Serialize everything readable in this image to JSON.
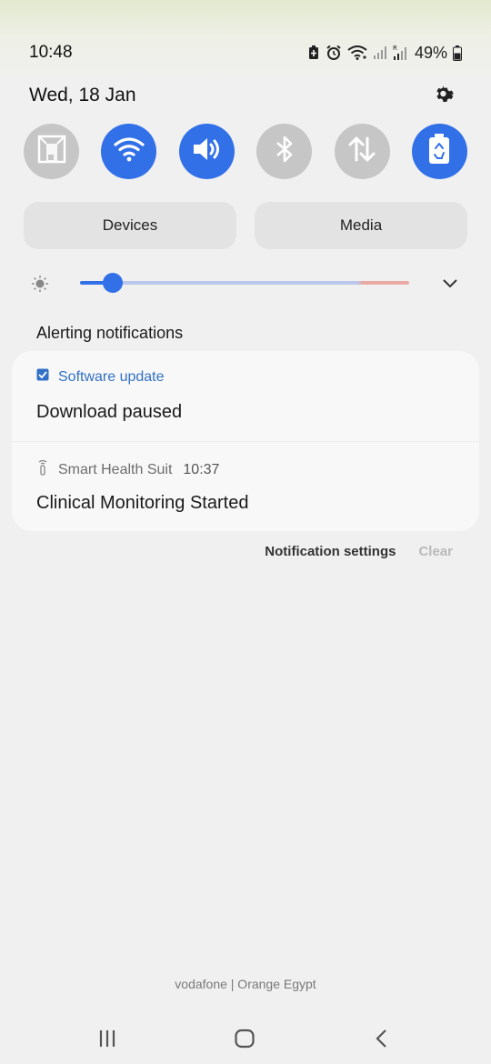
{
  "status_bar": {
    "time": "10:48",
    "battery_percent": "49%",
    "icons": [
      "battery-saver-icon",
      "alarm-icon",
      "wifi-icon",
      "signal-icon",
      "signal-roaming-icon",
      "battery-icon"
    ]
  },
  "header": {
    "date": "Wed, 18 Jan",
    "settings_icon": "gear-icon"
  },
  "quick_tiles": [
    {
      "name": "screen-capture",
      "icon": "screen-capture-icon",
      "active": false
    },
    {
      "name": "wifi",
      "icon": "wifi-icon",
      "active": true
    },
    {
      "name": "sound",
      "icon": "speaker-icon",
      "active": true
    },
    {
      "name": "bluetooth",
      "icon": "bluetooth-icon",
      "active": false
    },
    {
      "name": "mobile-data",
      "icon": "data-arrows-icon",
      "active": false
    },
    {
      "name": "power-saving",
      "icon": "battery-recycle-icon",
      "active": true
    }
  ],
  "pills": {
    "devices_label": "Devices",
    "media_label": "Media"
  },
  "brightness": {
    "level": 0.1,
    "icon": "sun-icon",
    "expand_icon": "chevron-down-icon"
  },
  "notifications": {
    "section_title": "Alerting notifications",
    "items": [
      {
        "app": "Software update",
        "app_icon": "checkbox-icon",
        "time": "",
        "body": "Download paused"
      },
      {
        "app": "Smart Health Suit",
        "app_icon": "sensor-icon",
        "time": "10:37",
        "body": "Clinical Monitoring Started"
      }
    ],
    "settings_label": "Notification settings",
    "clear_label": "Clear"
  },
  "carrier": "vodafone | Orange Egypt",
  "nav": {
    "recents_icon": "recents-icon",
    "home_icon": "home-icon",
    "back_icon": "back-icon"
  },
  "colors": {
    "accent": "#3270e8",
    "tile_off": "#c6c6c6"
  }
}
